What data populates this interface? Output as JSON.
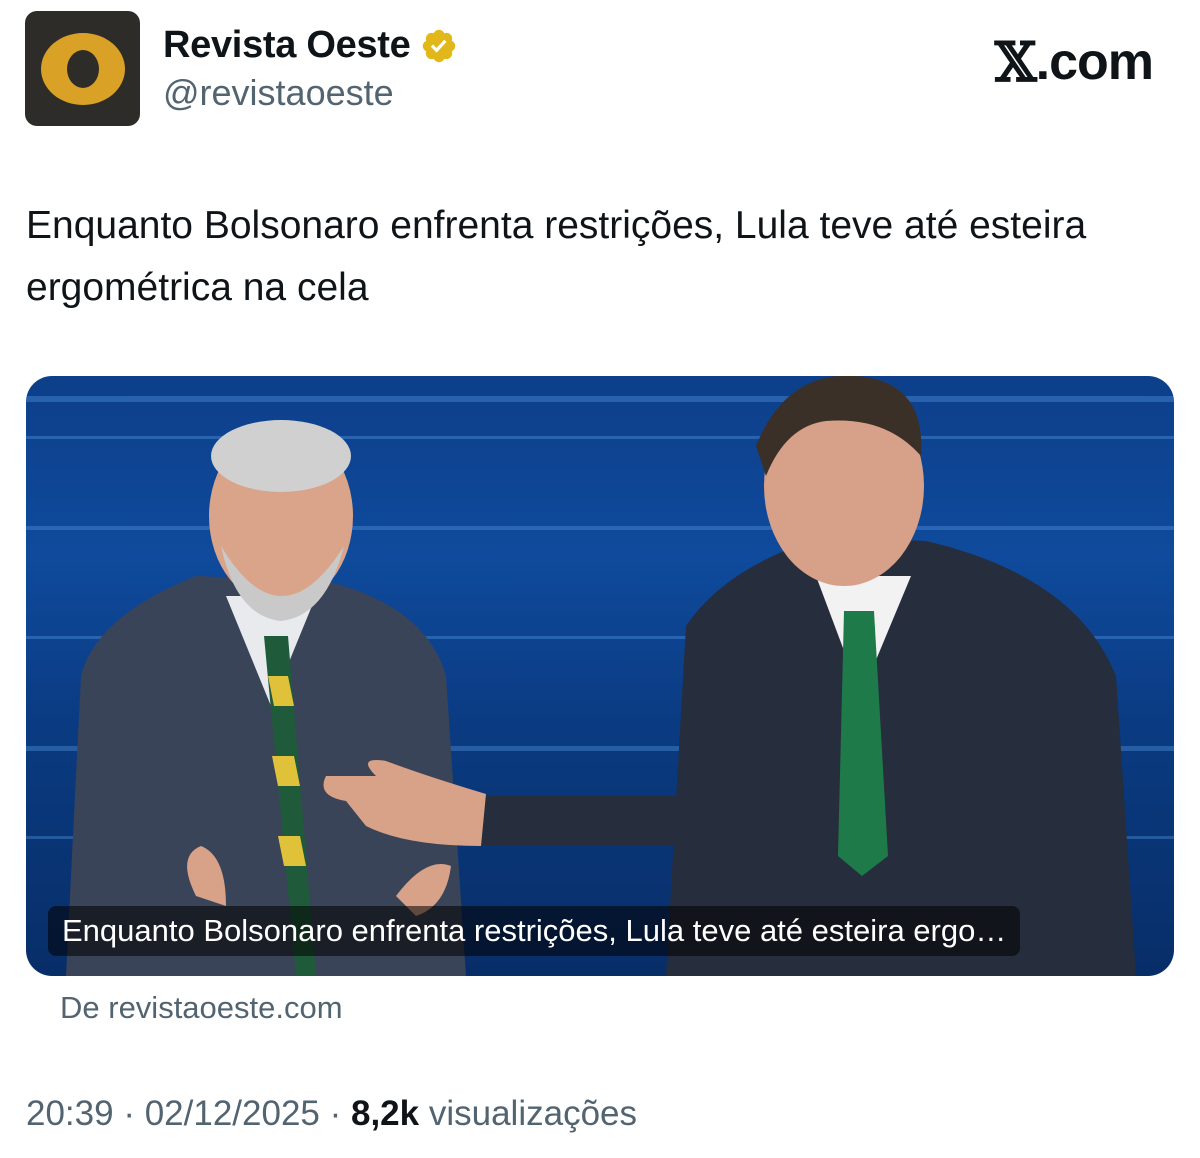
{
  "account": {
    "display_name": "Revista Oeste",
    "handle": "@revistaoeste",
    "verified_badge": "verified-badge-gold",
    "avatar_letter": "O",
    "avatar_colors": {
      "background": "#2e2c29",
      "ring": "#d9a227"
    }
  },
  "brand": {
    "glyph": "𝕏",
    "suffix": ".com"
  },
  "tweet": {
    "text": "Enquanto Bolsonaro enfrenta restrições, Lula teve até esteira ergométrica na cela"
  },
  "card": {
    "caption": "Enquanto Bolsonaro enfrenta restrições, Lula teve até esteira ergo…",
    "source": "De revistaoeste.com"
  },
  "meta": {
    "time": "20:39",
    "separator": " · ",
    "date": "02/12/2025",
    "views_count": "8,2k",
    "views_label": "visualizações"
  },
  "colors": {
    "text_primary": "#0f1419",
    "text_secondary": "#536471",
    "badge_gold": "#e2b719"
  }
}
